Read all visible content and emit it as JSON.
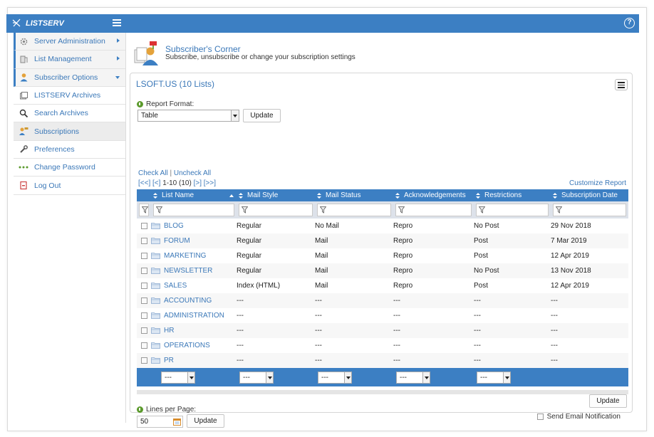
{
  "app": {
    "title": "LISTSERV",
    "help_label": "?"
  },
  "sidebar": {
    "items": [
      {
        "label": "Server Administration",
        "icon": "gear-icon",
        "type": "section",
        "arrow": "right"
      },
      {
        "label": "List Management",
        "icon": "list-icon",
        "type": "section",
        "arrow": "right"
      },
      {
        "label": "Subscriber Options",
        "icon": "user-icon",
        "type": "section",
        "arrow": "down"
      },
      {
        "label": "LISTSERV Archives",
        "icon": "archives-icon",
        "type": "link"
      },
      {
        "label": "Search Archives",
        "icon": "search-icon",
        "type": "link"
      },
      {
        "label": "Subscriptions",
        "icon": "subscriptions-icon",
        "type": "link",
        "active": true
      },
      {
        "label": "Preferences",
        "icon": "wrench-icon",
        "type": "link"
      },
      {
        "label": "Change Password",
        "icon": "password-icon",
        "type": "link"
      },
      {
        "label": "Log Out",
        "icon": "logout-icon",
        "type": "link"
      }
    ]
  },
  "header": {
    "title": "Subscriber's Corner",
    "subtitle": "Subscribe, unsubscribe or change your subscription settings"
  },
  "panel": {
    "title": "LSOFT.US (10 Lists)",
    "report_format_label": "Report Format:",
    "report_format_value": "Table",
    "update_label": "Update",
    "check_all": "Check All",
    "separator": "|",
    "uncheck_all": "Uncheck All",
    "pager_first": "[<<]",
    "pager_prev": "[<]",
    "pager_range": "1-10 (10)",
    "pager_next": "[>]",
    "pager_last": "[>>]",
    "customize_report": "Customize Report"
  },
  "table": {
    "columns": [
      "List Name",
      "Mail Style",
      "Mail Status",
      "Acknowledgements",
      "Restrictions",
      "Subscription Date"
    ],
    "rows": [
      {
        "name": "BLOG",
        "style": "Regular",
        "status": "No Mail",
        "ack": "Repro",
        "restr": "No Post",
        "date": "29 Nov 2018"
      },
      {
        "name": "FORUM",
        "style": "Regular",
        "status": "Mail",
        "ack": "Repro",
        "restr": "Post",
        "date": "7 Mar 2019"
      },
      {
        "name": "MARKETING",
        "style": "Regular",
        "status": "Mail",
        "ack": "Repro",
        "restr": "Post",
        "date": "12 Apr 2019"
      },
      {
        "name": "NEWSLETTER",
        "style": "Regular",
        "status": "Mail",
        "ack": "Repro",
        "restr": "No Post",
        "date": "13 Nov 2018"
      },
      {
        "name": "SALES",
        "style": "Index (HTML)",
        "status": "Mail",
        "ack": "Repro",
        "restr": "Post",
        "date": "12 Apr 2019"
      },
      {
        "name": "ACCOUNTING",
        "style": "---",
        "status": "---",
        "ack": "---",
        "restr": "---",
        "date": "---"
      },
      {
        "name": "ADMINISTRATION",
        "style": "---",
        "status": "---",
        "ack": "---",
        "restr": "---",
        "date": "---"
      },
      {
        "name": "HR",
        "style": "---",
        "status": "---",
        "ack": "---",
        "restr": "---",
        "date": "---"
      },
      {
        "name": "OPERATIONS",
        "style": "---",
        "status": "---",
        "ack": "---",
        "restr": "---",
        "date": "---"
      },
      {
        "name": "PR",
        "style": "---",
        "status": "---",
        "ack": "---",
        "restr": "---",
        "date": "---"
      }
    ],
    "footer_select_value": "---"
  },
  "bottom": {
    "lines_per_page_label": "Lines per Page:",
    "lines_per_page_value": "50",
    "update_label": "Update",
    "send_email_label": "Send Email Notification",
    "final_update_label": "Update"
  },
  "colors": {
    "accent": "#3c7fc3",
    "link": "#3b78b8"
  }
}
